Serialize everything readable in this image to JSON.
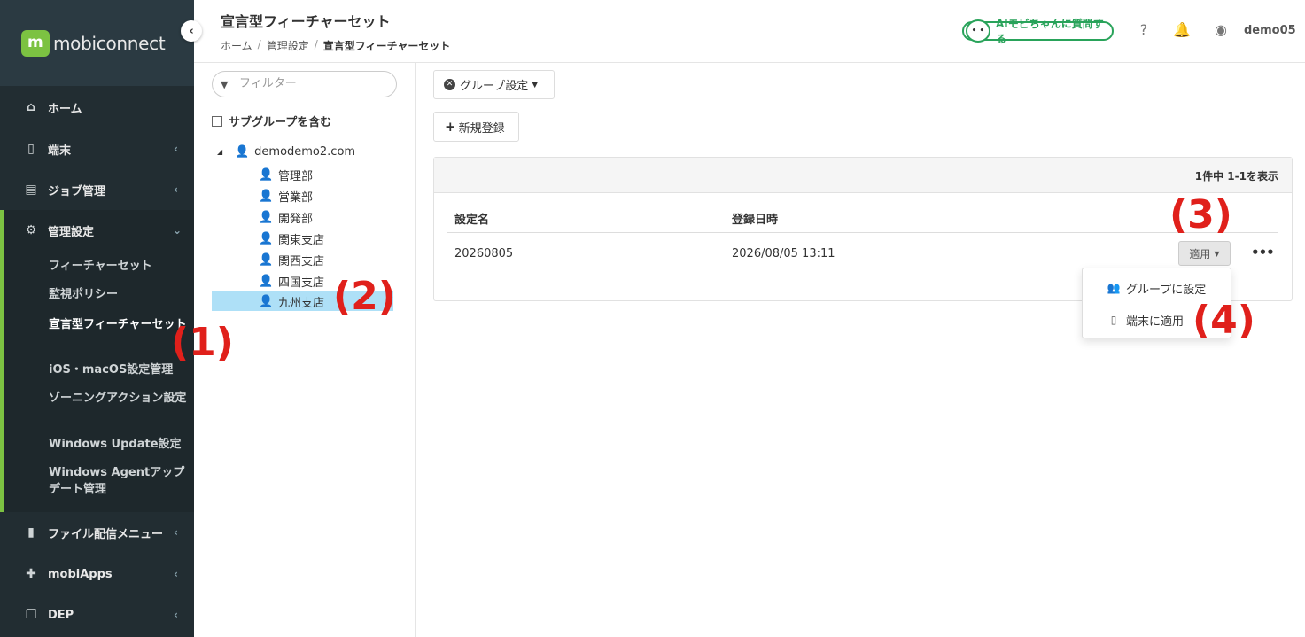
{
  "brand": {
    "logo_text": "mobiconnect",
    "accent": "#7cc242"
  },
  "header": {
    "title": "宣言型フィーチャーセット",
    "breadcrumb": [
      "ホーム",
      "管理設定",
      "宣言型フィーチャーセット"
    ],
    "ai_button": "AIモビちゃんに質問する",
    "user": "demo05"
  },
  "sidebar": {
    "items": [
      {
        "label": "ホーム",
        "icon": "home-icon"
      },
      {
        "label": "端末",
        "icon": "device-icon"
      },
      {
        "label": "ジョブ管理",
        "icon": "job-icon"
      },
      {
        "label": "管理設定",
        "icon": "gears-icon"
      },
      {
        "label": "ファイル配信メニュー",
        "icon": "file-icon"
      },
      {
        "label": "mobiApps",
        "icon": "puzzle-icon"
      },
      {
        "label": "DEP",
        "icon": "copy-icon"
      }
    ],
    "sub_items": [
      "フィーチャーセット",
      "監視ポリシー",
      "宣言型フィーチャーセット",
      "iOS・macOS設定管理",
      "ゾーニングアクション設定",
      "Windows Update設定",
      "Windows Agentアップデート管理"
    ]
  },
  "tree": {
    "filter_placeholder": "フィルター",
    "include_subgroups": "サブグループを含む",
    "root": "demodemo2.com",
    "nodes": [
      "管理部",
      "営業部",
      "開発部",
      "関東支店",
      "関西支店",
      "四国支店",
      "九州支店"
    ]
  },
  "toolbar": {
    "group_setting": "グループ設定",
    "new_register": "新規登録"
  },
  "table": {
    "count_text": "1件中 1-1を表示",
    "headers": [
      "設定名",
      "登録日時"
    ],
    "rows": [
      {
        "name": "20260805",
        "date": "2026/08/05 13:11"
      }
    ],
    "apply_label": "適用"
  },
  "dropdown": {
    "items": [
      "グループに設定",
      "端末に適用"
    ]
  },
  "annotations": [
    "(1)",
    "(2)",
    "(3)",
    "(4)"
  ]
}
